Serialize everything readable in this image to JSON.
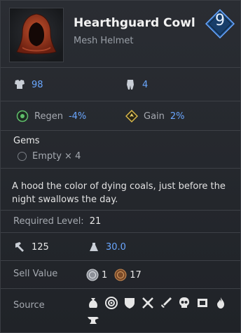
{
  "item": {
    "name": "Hearthguard Cowl",
    "type": "Mesh Helmet",
    "level": "9"
  },
  "stats": {
    "armor": "98",
    "encumbrance": "4"
  },
  "modifiers": {
    "regen_label": "Regen",
    "regen_value": "-4%",
    "gain_label": "Gain",
    "gain_value": "2%"
  },
  "gems": {
    "title": "Gems",
    "slot_text": "Empty × 4"
  },
  "description": "A hood the color of dying coals, just before the night swallows the day.",
  "requirements": {
    "label": "Required Level:",
    "value": "21"
  },
  "physical": {
    "durability": "125",
    "weight": "30.0"
  },
  "sell": {
    "label": "Sell Value",
    "silver": "1",
    "copper": "17"
  },
  "source": {
    "label": "Source",
    "icons": [
      "pouch-icon",
      "target-icon",
      "shield-icon",
      "crossed-tools-icon",
      "sword-icon",
      "skull-icon",
      "scroll-icon",
      "flame-icon",
      "anvil-icon"
    ]
  },
  "colors": {
    "accent_blue": "#6aa7ff",
    "badge_blue": "#1f4f86"
  }
}
